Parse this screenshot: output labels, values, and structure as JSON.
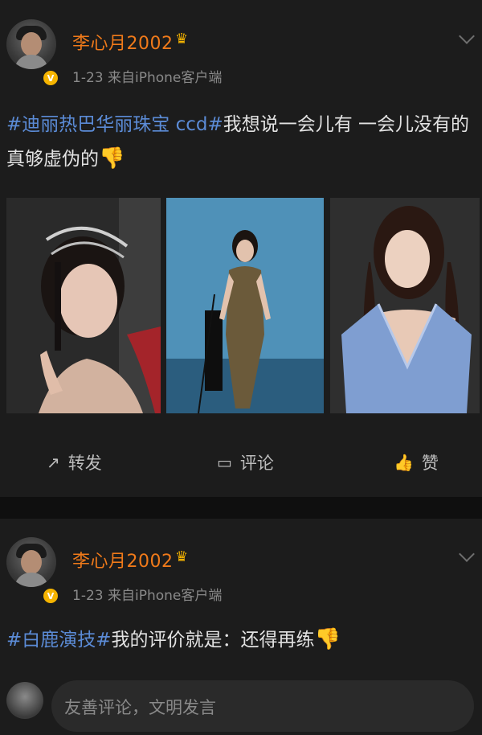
{
  "posts": [
    {
      "username": "李心月2002",
      "crown_icon": "crown-icon",
      "verified_icon": "v-badge-icon",
      "date": "1-23",
      "source_prefix": "来自",
      "source": "iPhone客户端",
      "hashtag": "#迪丽热巴华丽珠宝 ccd#",
      "body_line1": "我想说一会儿有 一会儿没有的",
      "body_line2": "真够虚伪的",
      "emoji": "👎",
      "actions": {
        "repost": "转发",
        "comment": "评论",
        "like": "赞"
      }
    },
    {
      "username": "李心月2002",
      "date": "1-23",
      "source_prefix": "来自",
      "source": "iPhone客户端",
      "hashtag": "#白鹿演技#",
      "body": "我的评价就是：还得再练",
      "emoji": "👎"
    }
  ],
  "comment_input": {
    "placeholder": "友善评论，文明发言"
  },
  "colors": {
    "username": "#f07a1a",
    "hashtag": "#5b8bd6",
    "background": "#1c1c1c"
  }
}
